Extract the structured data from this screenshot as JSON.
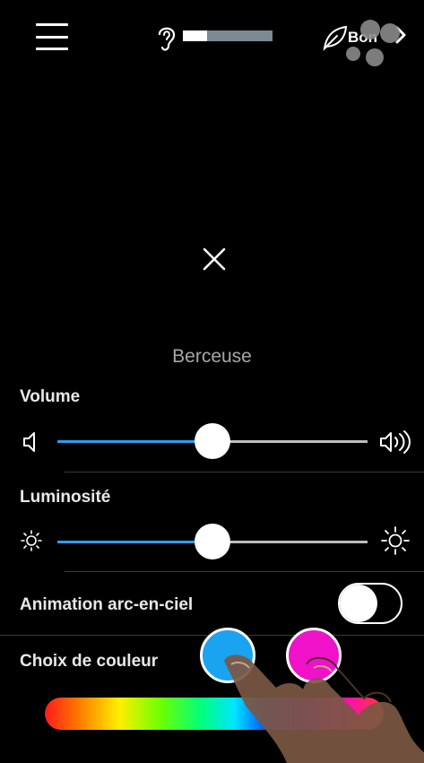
{
  "topbar": {
    "menu_icon": "hamburger-menu-icon",
    "noise_icon": "ear-icon",
    "noise_level": 0.27,
    "air_icon": "leaf-icon",
    "air_quality_label": "Bon",
    "chevron_icon": "chevron-right-icon"
  },
  "close_icon": "close-icon",
  "mode_name": "Berceuse",
  "volume": {
    "label": "Volume",
    "value": 0.5,
    "low_icon": "speaker-low-icon",
    "high_icon": "speaker-high-icon",
    "accent": "#2a9df4"
  },
  "brightness": {
    "label": "Luminosité",
    "value": 0.5,
    "low_icon": "sun-dim-icon",
    "high_icon": "sun-bright-icon",
    "accent": "#2a9df4"
  },
  "rainbow_animation": {
    "label": "Animation arc-en-ciel",
    "enabled": false
  },
  "color_choice": {
    "label": "Choix de couleur",
    "colors": [
      "#1aa3f0",
      "#f012c8"
    ]
  }
}
